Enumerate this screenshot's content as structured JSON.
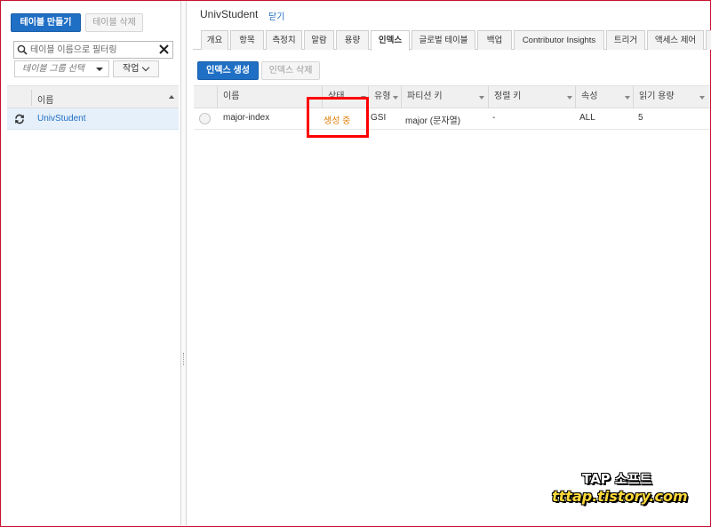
{
  "left_panel": {
    "create_table_label": "테이블 만들기",
    "delete_table_label": "테이블 삭제",
    "filter_placeholder": "테이블 이름으로 필터링",
    "group_select_placeholder": "테이블 그룹 선택",
    "actions_label": "작업",
    "column_header": "이름",
    "tables": [
      {
        "name": "UnivStudent",
        "selected": true
      }
    ]
  },
  "detail": {
    "table_name": "UnivStudent",
    "close_label": "닫기",
    "tabs": [
      {
        "label": "개요"
      },
      {
        "label": "항목"
      },
      {
        "label": "측정치"
      },
      {
        "label": "알람"
      },
      {
        "label": "용량"
      },
      {
        "label": "인덱스",
        "active": true
      },
      {
        "label": "글로벌 테이블"
      },
      {
        "label": "백업"
      },
      {
        "label": "Contributor Insights"
      },
      {
        "label": "트리거"
      },
      {
        "label": "액세스 제어"
      }
    ],
    "create_index_label": "인덱스 생성",
    "delete_index_label": "인덱스 삭제",
    "index_table": {
      "columns": [
        "이름",
        "상태",
        "유형",
        "파티션 키",
        "정렬 키",
        "속성",
        "읽기 용량"
      ],
      "rows": [
        {
          "name": "major-index",
          "status": "생성 중",
          "type": "GSI",
          "partition_key": "major (문자열)",
          "sort_key": "-",
          "attributes": "ALL",
          "read_capacity": "5"
        }
      ]
    }
  },
  "colors": {
    "primary": "#1f6fc5",
    "status_creating": "#e07b00",
    "highlight": "#ff0000"
  },
  "watermark": {
    "line1": "TAP 소프트",
    "line2": "tttap.tistory.com"
  }
}
